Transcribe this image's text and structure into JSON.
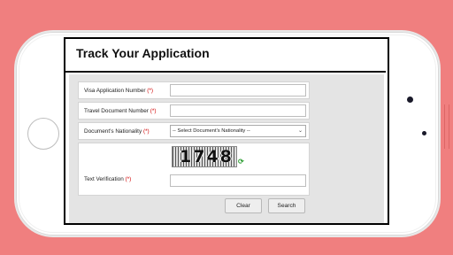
{
  "page": {
    "title": "Track Your Application"
  },
  "form": {
    "visa_number": {
      "label": "Visa Application Number",
      "required_mark": "(*)",
      "value": ""
    },
    "travel_document": {
      "label": "Travel Document Number",
      "required_mark": "(*)",
      "value": ""
    },
    "nationality": {
      "label": "Document's Nationality",
      "required_mark": "(*)",
      "selected": "-- Select Document's Nationality --"
    },
    "verification": {
      "label": "Text Verification",
      "required_mark": "(*)",
      "captcha_text": "1748",
      "value": ""
    }
  },
  "buttons": {
    "clear": "Clear",
    "search": "Search"
  },
  "colors": {
    "background": "#f07f7f",
    "required": "#d00000",
    "panel": "#e4e4e4"
  }
}
